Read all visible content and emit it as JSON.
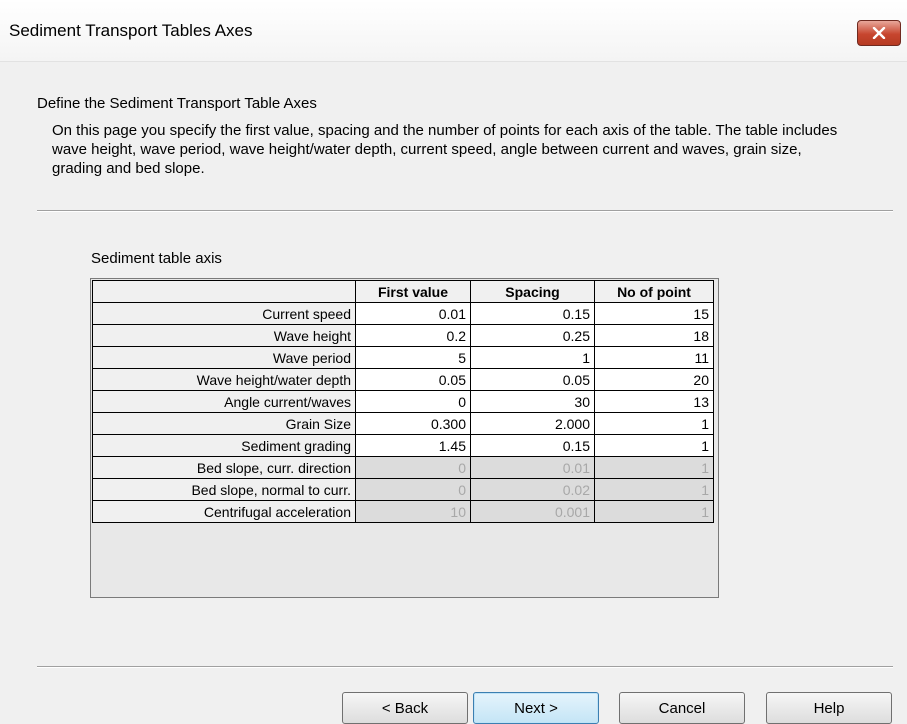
{
  "window": {
    "title": "Sediment Transport Tables Axes",
    "close_icon": "close-icon"
  },
  "page": {
    "heading": "Define the Sediment Transport Table Axes",
    "description": "On this page you specify the first value, spacing and the number of points for each axis of the table. The table includes wave height, wave period, wave height/water depth, current speed, angle between current and waves, grain size, grading and  bed slope."
  },
  "table": {
    "label": "Sediment table axis",
    "columns": [
      "",
      "First value",
      "Spacing",
      "No of point"
    ],
    "rows": [
      {
        "name": "Current speed",
        "first": "0.01",
        "spacing": "0.15",
        "points": "15",
        "enabled": true
      },
      {
        "name": "Wave height",
        "first": "0.2",
        "spacing": "0.25",
        "points": "18",
        "enabled": true
      },
      {
        "name": "Wave period",
        "first": "5",
        "spacing": "1",
        "points": "11",
        "enabled": true
      },
      {
        "name": "Wave height/water depth",
        "first": "0.05",
        "spacing": "0.05",
        "points": "20",
        "enabled": true
      },
      {
        "name": "Angle current/waves",
        "first": "0",
        "spacing": "30",
        "points": "13",
        "enabled": true
      },
      {
        "name": "Grain Size",
        "first": "0.300",
        "spacing": "2.000",
        "points": "1",
        "enabled": true
      },
      {
        "name": "Sediment grading",
        "first": "1.45",
        "spacing": "0.15",
        "points": "1",
        "enabled": true
      },
      {
        "name": "Bed slope, curr. direction",
        "first": "0",
        "spacing": "0.01",
        "points": "1",
        "enabled": false
      },
      {
        "name": "Bed slope, normal to curr.",
        "first": "0",
        "spacing": "0.02",
        "points": "1",
        "enabled": false
      },
      {
        "name": "Centrifugal acceleration",
        "first": "10",
        "spacing": "0.001",
        "points": "1",
        "enabled": false
      }
    ]
  },
  "buttons": {
    "back": "< Back",
    "next": "Next >",
    "cancel": "Cancel",
    "help": "Help"
  }
}
